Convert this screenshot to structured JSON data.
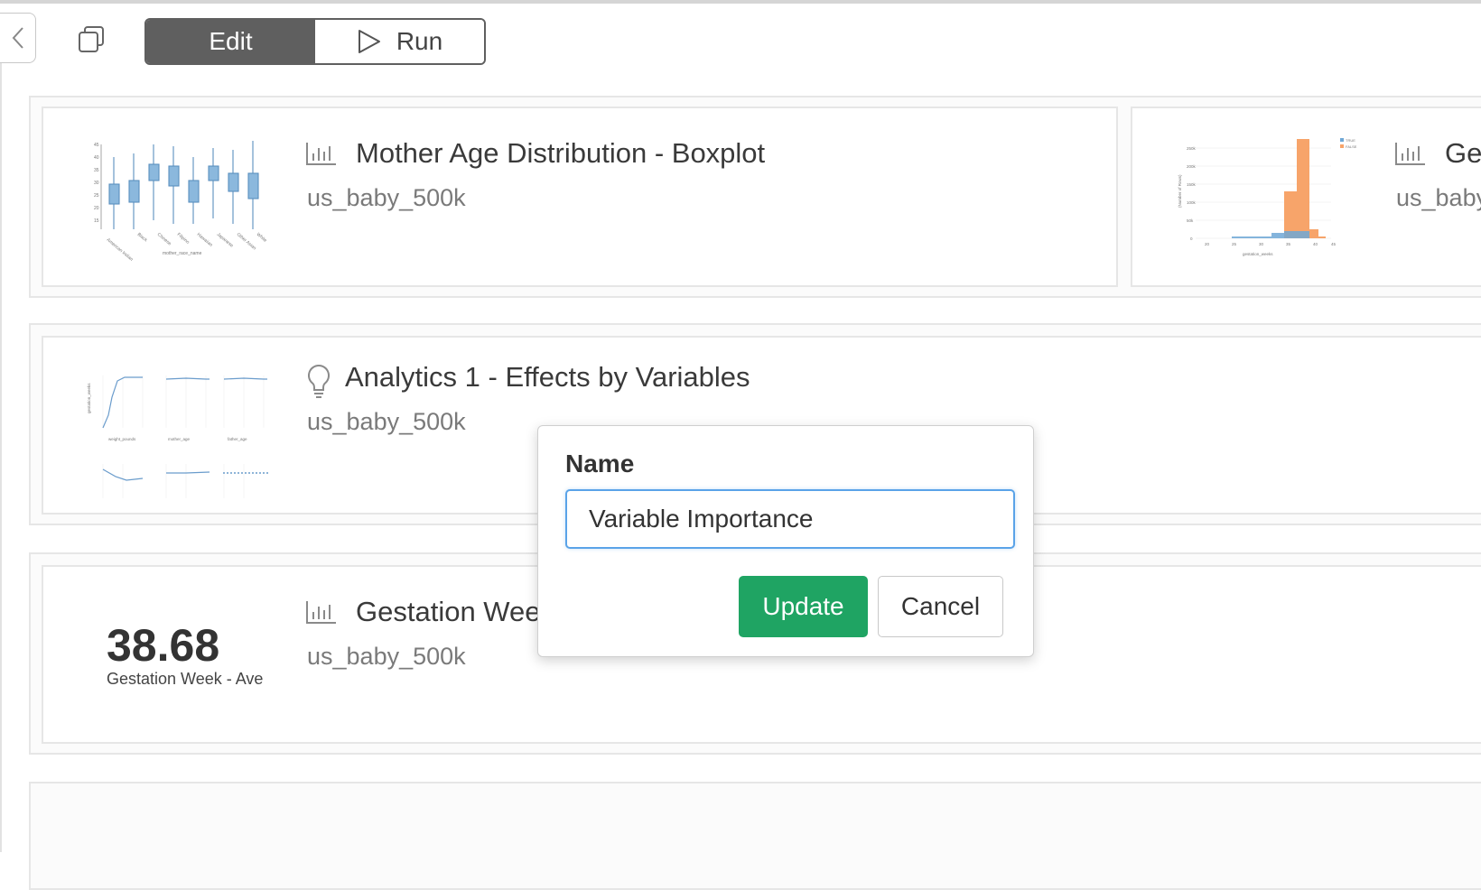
{
  "toolbar": {
    "back_icon": "chevron-left-icon",
    "copy_icon": "copy-icon",
    "edit_label": "Edit",
    "run_label": "Run",
    "run_icon": "play-icon"
  },
  "cards": [
    {
      "title": "Mother Age Distribution - Boxplot",
      "subtitle": "us_baby_500k",
      "icon": "bar-chart-icon",
      "thumbnail": "boxplot"
    },
    {
      "title": "Ge",
      "subtitle": "us_baby",
      "icon": "bar-chart-icon",
      "thumbnail": "histogram"
    },
    {
      "title": "Analytics 1 - Effects by Variables",
      "subtitle": "us_baby_500k",
      "icon": "lightbulb-icon",
      "thumbnail": "effect-lines"
    },
    {
      "title": "Gestation Wee",
      "subtitle": "us_baby_500k",
      "icon": "bar-chart-icon",
      "thumbnail": "kpi",
      "kpi_value": "38.68",
      "kpi_label": "Gestation Week - Ave"
    }
  ],
  "popover": {
    "label": "Name",
    "input_value": "Variable Importance",
    "update_label": "Update",
    "cancel_label": "Cancel"
  },
  "colors": {
    "accent_dark": "#5f5f5f",
    "update_green": "#1fa463",
    "input_focus": "#5aa3e8",
    "chart_blue": "#6fa8d6",
    "chart_orange": "#f7a46a"
  }
}
